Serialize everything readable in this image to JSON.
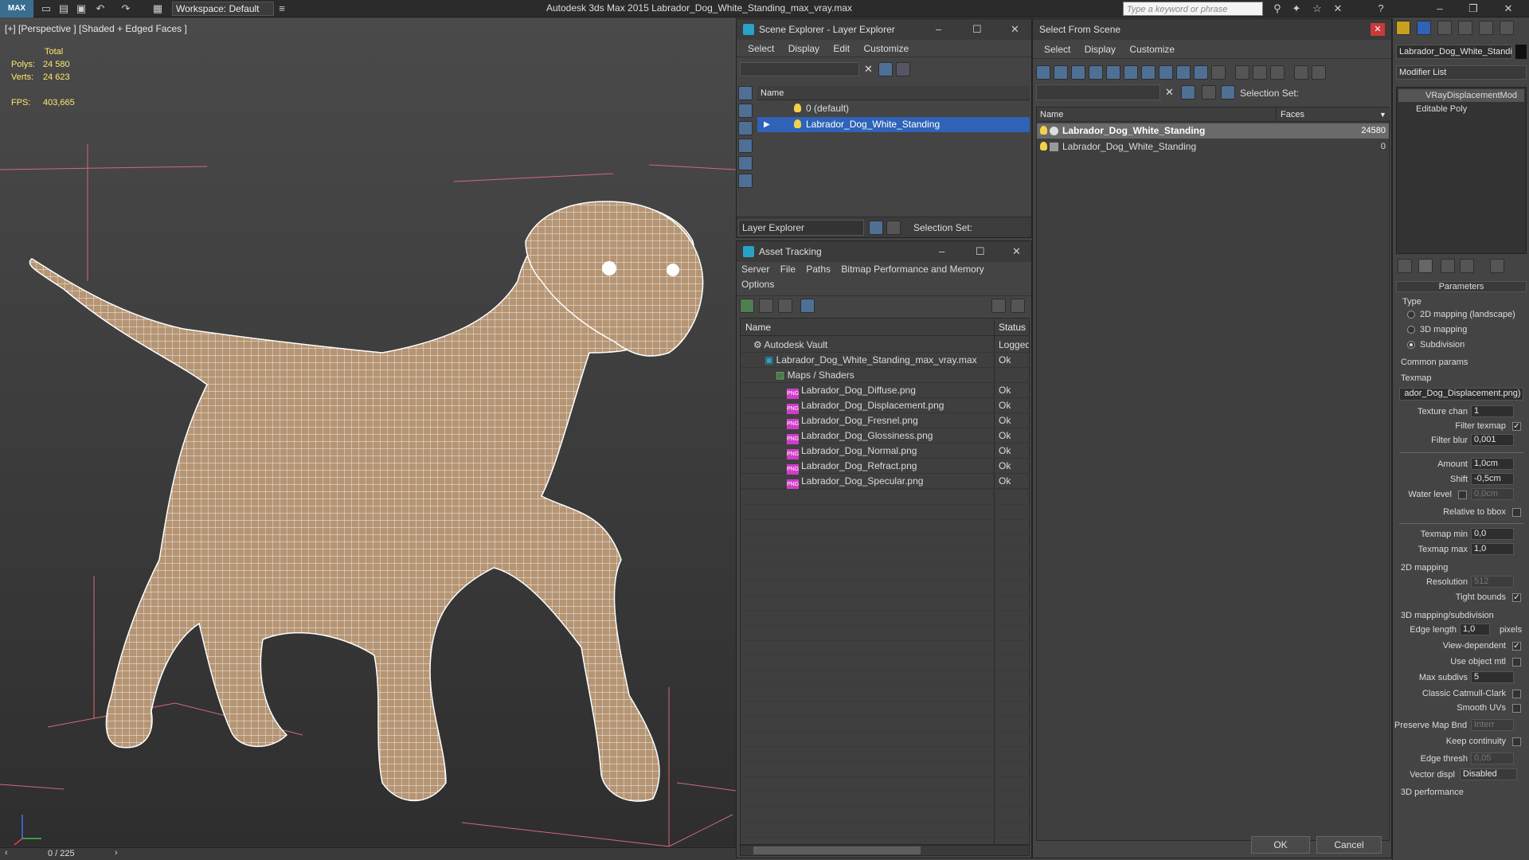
{
  "topbar": {
    "logo": "MAX",
    "workspace": "Workspace: Default",
    "title": "Autodesk 3ds Max  2015    Labrador_Dog_White_Standing_max_vray.max",
    "search_placeholder": "Type a keyword or phrase"
  },
  "viewport": {
    "label": "[+] [Perspective ] [Shaded + Edged Faces ]",
    "stats": {
      "header": "Total",
      "polys_label": "Polys:",
      "polys": "24 580",
      "verts_label": "Verts:",
      "verts": "24 623",
      "fps_label": "FPS:",
      "fps": "403,665"
    },
    "timeslider": "0 / 225"
  },
  "scene_explorer": {
    "title": "Scene Explorer - Layer Explorer",
    "menu": [
      "Select",
      "Display",
      "Edit",
      "Customize"
    ],
    "column": "Name",
    "rows": [
      "0 (default)",
      "Labrador_Dog_White_Standing"
    ],
    "footer_dropdown": "Layer Explorer",
    "selection_set": "Selection Set:"
  },
  "asset_tracking": {
    "title": "Asset Tracking",
    "menu": [
      "Server",
      "File",
      "Paths",
      "Bitmap Performance and Memory",
      "Options"
    ],
    "col_name": "Name",
    "col_status": "Status",
    "rows": [
      {
        "name": "Autodesk Vault",
        "status": "Logged",
        "indent": 0,
        "kind": "vault"
      },
      {
        "name": "Labrador_Dog_White_Standing_max_vray.max",
        "status": "Ok",
        "indent": 1,
        "kind": "max"
      },
      {
        "name": "Maps / Shaders",
        "status": "",
        "indent": 2,
        "kind": "folder"
      },
      {
        "name": "Labrador_Dog_Diffuse.png",
        "status": "Ok",
        "indent": 3,
        "kind": "png"
      },
      {
        "name": "Labrador_Dog_Displacement.png",
        "status": "Ok",
        "indent": 3,
        "kind": "png"
      },
      {
        "name": "Labrador_Dog_Fresnel.png",
        "status": "Ok",
        "indent": 3,
        "kind": "png"
      },
      {
        "name": "Labrador_Dog_Glossiness.png",
        "status": "Ok",
        "indent": 3,
        "kind": "png"
      },
      {
        "name": "Labrador_Dog_Normal.png",
        "status": "Ok",
        "indent": 3,
        "kind": "png"
      },
      {
        "name": "Labrador_Dog_Refract.png",
        "status": "Ok",
        "indent": 3,
        "kind": "png"
      },
      {
        "name": "Labrador_Dog_Specular.png",
        "status": "Ok",
        "indent": 3,
        "kind": "png"
      }
    ]
  },
  "select_from_scene": {
    "title": "Select From Scene",
    "menu": [
      "Select",
      "Display",
      "Customize"
    ],
    "selection_set": "Selection Set:",
    "col_name": "Name",
    "col_faces": "Faces",
    "rows": [
      {
        "name": "Labrador_Dog_White_Standing",
        "faces": "24580"
      },
      {
        "name": "Labrador_Dog_White_Standing",
        "faces": "0"
      }
    ],
    "ok": "OK",
    "cancel": "Cancel"
  },
  "command_panel": {
    "object_name": "Labrador_Dog_White_Standir",
    "modifier_list": "Modifier List",
    "stack": [
      "VRayDisplacementMod",
      "Editable Poly"
    ],
    "rollout": "Parameters",
    "type_label": "Type",
    "type_options": [
      "2D mapping (landscape)",
      "3D mapping",
      "Subdivision"
    ],
    "common_params": "Common params",
    "texmap_label": "Texmap",
    "texmap": "ador_Dog_Displacement.png)",
    "texture_chan_label": "Texture chan",
    "texture_chan": "1",
    "filter_texmap": "Filter texmap",
    "filter_blur_label": "Filter blur",
    "filter_blur": "0,001",
    "amount_label": "Amount",
    "amount": "1,0cm",
    "shift_label": "Shift",
    "shift": "-0,5cm",
    "water_label": "Water level",
    "water": "0,0cm",
    "relative_bbox": "Relative to bbox",
    "texmap_min_label": "Texmap min",
    "texmap_min": "0,0",
    "texmap_max_label": "Texmap max",
    "texmap_max": "1,0",
    "mapping2d": "2D mapping",
    "resolution_label": "Resolution",
    "resolution": "512",
    "tight_bounds": "Tight bounds",
    "mapping3d": "3D mapping/subdivision",
    "edge_length_label": "Edge length",
    "edge_length": "1,0",
    "pixels": "pixels",
    "view_dependent": "View-dependent",
    "use_object_mtl": "Use object mtl",
    "max_subdivs_label": "Max subdivs",
    "max_subdivs": "5",
    "classic_catmull": "Classic Catmull-Clark",
    "smooth_uvs": "Smooth UVs",
    "preserve_label": "Preserve Map Bnd",
    "preserve": "Interr",
    "keep_continuity": "Keep continuity",
    "edge_thresh_label": "Edge thresh",
    "edge_thresh": "0,05",
    "vector_disp_label": "Vector displ",
    "vector_disp": "Disabled",
    "perf3d": "3D performance"
  },
  "colors": {
    "selection": "#2e63b8",
    "wire": "#ffffff",
    "mesh": "#b59574"
  }
}
